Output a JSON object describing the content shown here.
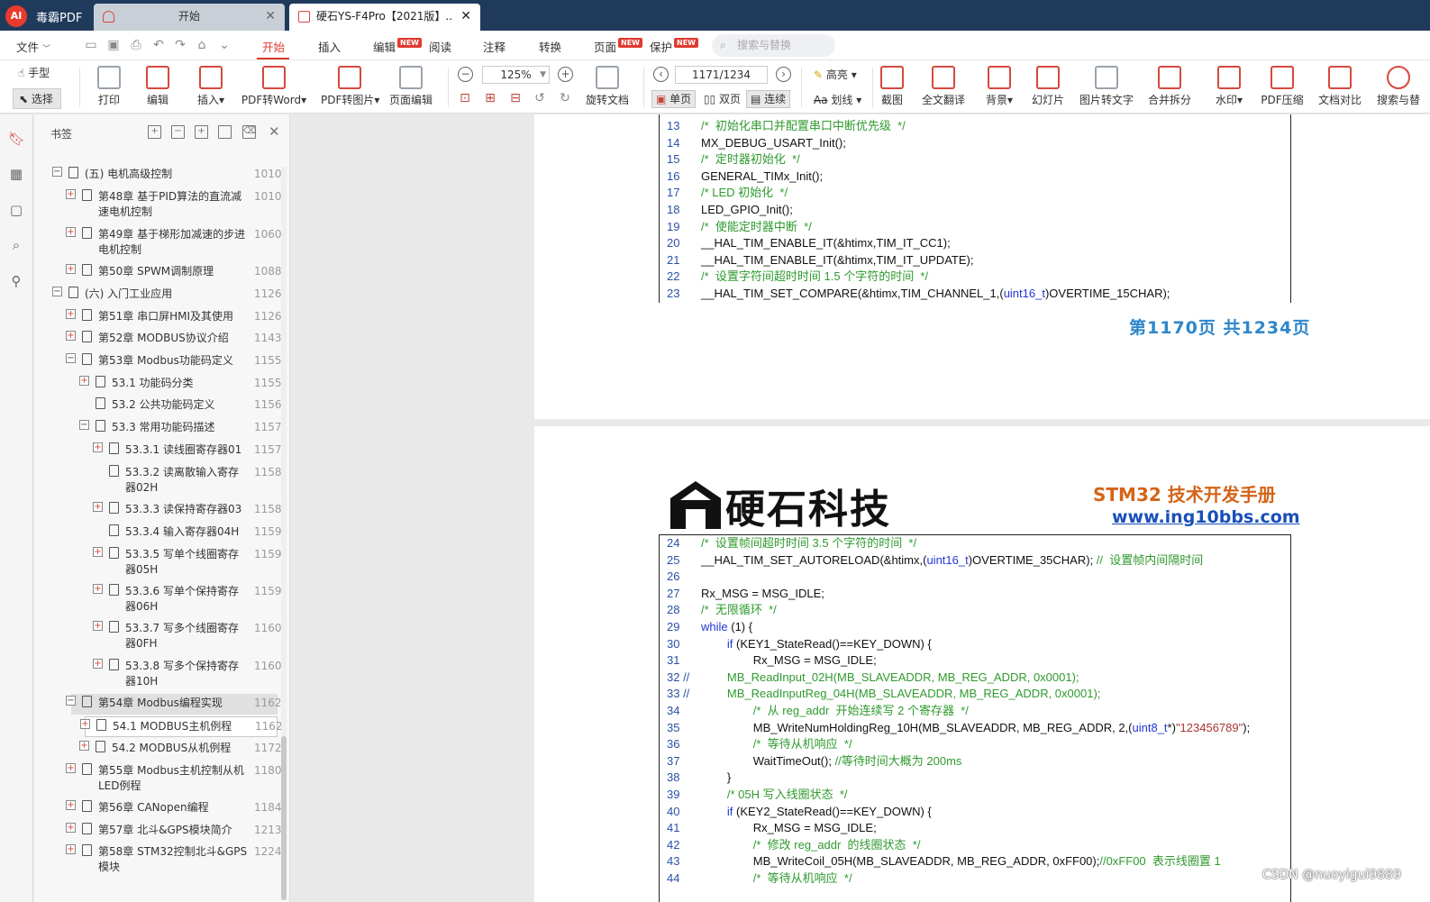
{
  "titlebar": {
    "app_name": "毒霸PDF",
    "tabs": [
      {
        "label": "开始"
      },
      {
        "label": "硬石YS-F4Pro【2021版】..."
      }
    ]
  },
  "menubar": {
    "file": "文件",
    "items": [
      {
        "label": "开始"
      },
      {
        "label": "插入"
      },
      {
        "label": "编辑",
        "badge": "NEW"
      },
      {
        "label": "阅读"
      },
      {
        "label": "注释"
      },
      {
        "label": "转换"
      },
      {
        "label": "页面",
        "badge": "NEW"
      },
      {
        "label": "保护",
        "badge": "NEW"
      }
    ],
    "search_placeholder": "搜索与替换"
  },
  "toolbar": {
    "hand": "手型",
    "select": "选择",
    "print": "打印",
    "edit": "编辑",
    "insert": "插入",
    "pdf_to_word": "PDF转Word",
    "pdf_to_image": "PDF转图片",
    "page_edit": "页面编辑",
    "zoom": "125%",
    "rotate": "旋转文档",
    "page_input": "1171/1234",
    "single": "单页",
    "double": "双页",
    "continuous": "连续",
    "highlight": "高亮",
    "strike": "划线",
    "screenshot": "截图",
    "translate": "全文翻译",
    "background": "背景",
    "slideshow": "幻灯片",
    "ocr": "图片转文字",
    "merge_split": "合并拆分",
    "watermark": "水印",
    "compress": "PDF压缩",
    "compare": "文档对比",
    "search_more": "搜索与替"
  },
  "panel": {
    "title": "书签",
    "items": [
      {
        "label": "(五) 电机高级控制",
        "page": "1010"
      },
      {
        "label": "第48章 基于PID算法的直流减速电机控制",
        "page": "1010"
      },
      {
        "label": "第49章 基于梯形加减速的步进电机控制",
        "page": "1060"
      },
      {
        "label": "第50章 SPWM调制原理",
        "page": "1088"
      },
      {
        "label": "(六) 入门工业应用",
        "page": "1126"
      },
      {
        "label": "第51章 串口屏HMI及其使用",
        "page": "1126"
      },
      {
        "label": "第52章 MODBUS协议介绍",
        "page": "1143"
      },
      {
        "label": "第53章 Modbus功能码定义",
        "page": "1155"
      },
      {
        "label": "53.1 功能码分类",
        "page": "1155"
      },
      {
        "label": "53.2 公共功能码定义",
        "page": "1156"
      },
      {
        "label": "53.3 常用功能码描述",
        "page": "1157"
      },
      {
        "label": "53.3.1 读线圈寄存器01",
        "page": "1157"
      },
      {
        "label": "53.3.2 读离散输入寄存器02H",
        "page": "1158"
      },
      {
        "label": "53.3.3 读保持寄存器03",
        "page": "1158"
      },
      {
        "label": "53.3.4 输入寄存器04H",
        "page": "1159"
      },
      {
        "label": "53.3.5 写单个线圈寄存器05H",
        "page": "1159"
      },
      {
        "label": "53.3.6 写单个保持寄存器06H",
        "page": "1159"
      },
      {
        "label": "53.3.7 写多个线圈寄存器0FH",
        "page": "1160"
      },
      {
        "label": "53.3.8 写多个保持寄存器10H",
        "page": "1160"
      },
      {
        "label": "第54章 Modbus编程实现",
        "page": "1162"
      },
      {
        "label": "54.1 MODBUS主机例程",
        "page": "1162"
      },
      {
        "label": "54.2 MODBUS从机例程",
        "page": "1172"
      },
      {
        "label": "第55章 Modbus主机控制从机LED例程",
        "page": "1180"
      },
      {
        "label": "第56章 CANopen编程",
        "page": "1184"
      },
      {
        "label": "第57章 北斗&GPS模块简介",
        "page": "1213"
      },
      {
        "label": "第58章 STM32控制北斗&GPS模块",
        "page": "1224"
      }
    ]
  },
  "doc": {
    "page1_lines": [
      {
        "n": "13",
        "t": "/*  初始化串口并配置串口中断优先级  */"
      },
      {
        "n": "14",
        "t": "MX_DEBUG_USART_Init();"
      },
      {
        "n": "15",
        "t": "/*  定时器初始化  */"
      },
      {
        "n": "16",
        "t": "GENERAL_TIMx_Init();"
      },
      {
        "n": "17",
        "t": "/* LED 初始化  */"
      },
      {
        "n": "18",
        "t": "LED_GPIO_Init();"
      },
      {
        "n": "19",
        "t": "/*  使能定时器中断  */"
      },
      {
        "n": "20",
        "t": "__HAL_TIM_ENABLE_IT(&htimx,TIM_IT_CC1);"
      },
      {
        "n": "21",
        "t": "__HAL_TIM_ENABLE_IT(&htimx,TIM_IT_UPDATE);"
      },
      {
        "n": "22",
        "t": "/*  设置字符间超时时间 1.5 个字符的时间  */"
      },
      {
        "n": "23",
        "t": "__HAL_TIM_SET_COMPARE(&htimx,TIM_CHANNEL_1,(uint16_t)OVERTIME_15CHAR);"
      }
    ],
    "page1_footer": "第1170页  共1234页",
    "brand": "硬石科技",
    "header_title": "STM32 技术开发手册",
    "header_url": "www.ing10bbs.com",
    "page2_lines": [
      {
        "n": "24",
        "t": "/*  设置帧间超时时间 3.5 个字符的时间  */"
      },
      {
        "n": "25",
        "t": "__HAL_TIM_SET_AUTORELOAD(&htimx,(uint16_t)OVERTIME_35CHAR); //  设置帧内间隔时间"
      },
      {
        "n": "26",
        "t": ""
      },
      {
        "n": "27",
        "t": "Rx_MSG = MSG_IDLE;"
      },
      {
        "n": "28",
        "t": "/*  无限循环  */"
      },
      {
        "n": "29",
        "t": "while (1) {"
      },
      {
        "n": "30",
        "t": "        if (KEY1_StateRead()==KEY_DOWN) {"
      },
      {
        "n": "31",
        "t": "                Rx_MSG = MSG_IDLE;"
      },
      {
        "n": "32 //",
        "t": "        MB_ReadInput_02H(MB_SLAVEADDR, MB_REG_ADDR, 0x0001);"
      },
      {
        "n": "33 //",
        "t": "        MB_ReadInputReg_04H(MB_SLAVEADDR, MB_REG_ADDR, 0x0001);"
      },
      {
        "n": "34",
        "t": "                /*  从 reg_addr  开始连续写 2 个寄存器  */"
      },
      {
        "n": "35",
        "t": "                MB_WriteNumHoldingReg_10H(MB_SLAVEADDR, MB_REG_ADDR, 2,(uint8_t*)\"123456789\");"
      },
      {
        "n": "36",
        "t": "                /*  等待从机响应  */"
      },
      {
        "n": "37",
        "t": "                WaitTimeOut(); //等待时间大概为 200ms"
      },
      {
        "n": "38",
        "t": "        }"
      },
      {
        "n": "39",
        "t": "        /* 05H 写入线圈状态  */"
      },
      {
        "n": "40",
        "t": "        if (KEY2_StateRead()==KEY_DOWN) {"
      },
      {
        "n": "41",
        "t": "                Rx_MSG = MSG_IDLE;"
      },
      {
        "n": "42",
        "t": "                /*  修改 reg_addr  的线圈状态  */"
      },
      {
        "n": "43",
        "t": "                MB_WriteCoil_05H(MB_SLAVEADDR, MB_REG_ADDR, 0xFF00);//0xFF00  表示线圈置 1"
      },
      {
        "n": "44",
        "t": "                /*  等待从机响应  */"
      }
    ],
    "watermark": "CSDN @nuoyigui9889"
  }
}
